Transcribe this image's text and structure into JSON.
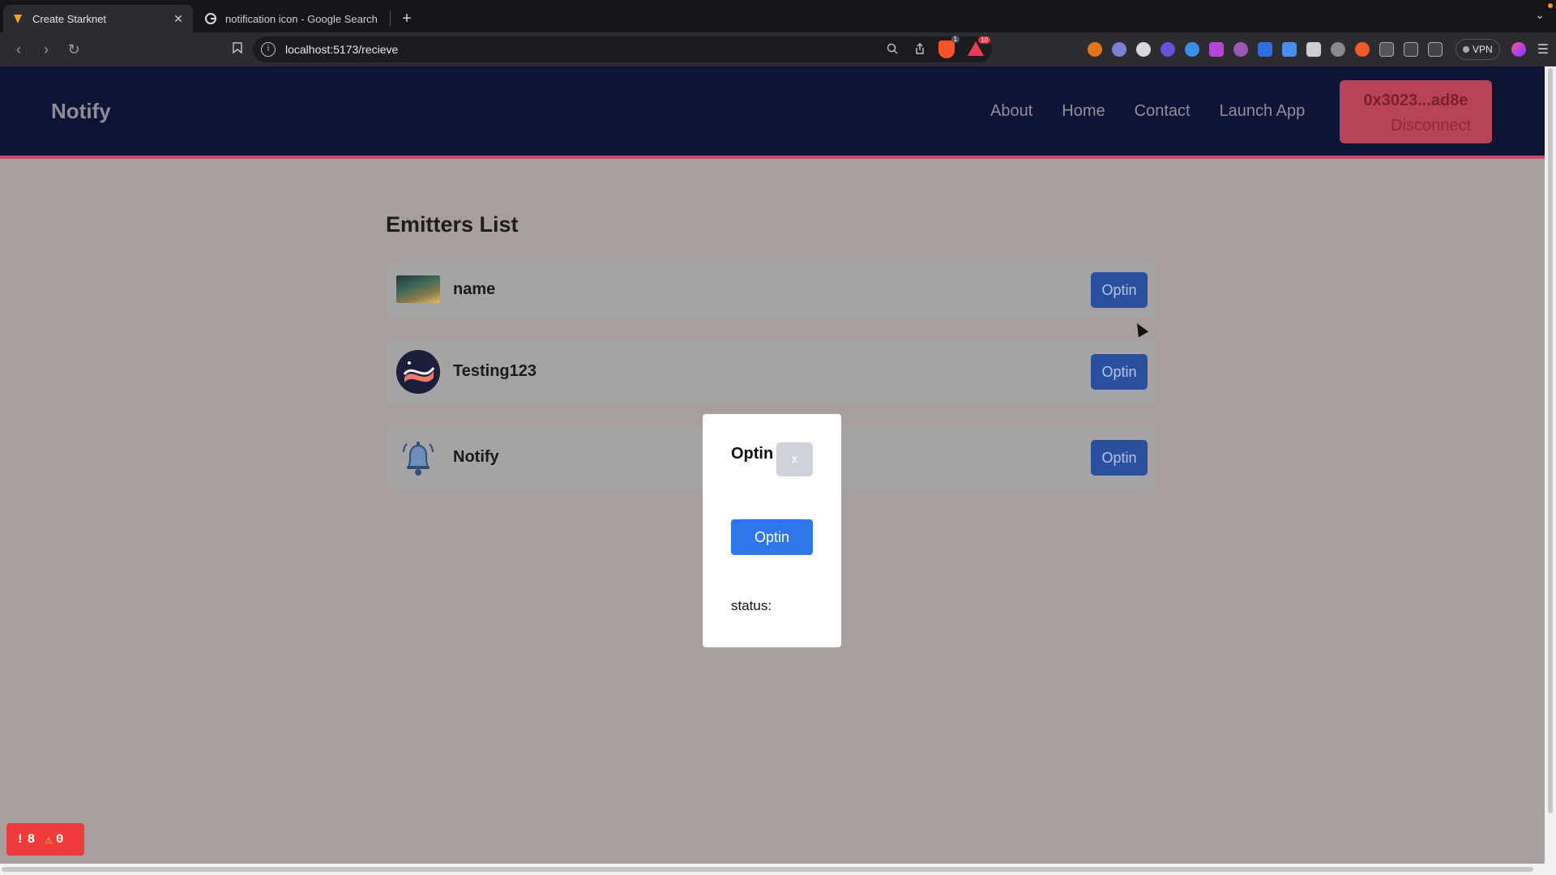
{
  "browser": {
    "tabs": [
      {
        "title": "Create Starknet",
        "active": true
      },
      {
        "title": "notification icon - Google Search",
        "active": false
      }
    ],
    "url": "localhost:5173/recieve",
    "shield_badge": "1",
    "rewards_badge": "10",
    "vpn_label": "VPN"
  },
  "navbar": {
    "brand": "Notify",
    "links": [
      "About",
      "Home",
      "Contact",
      "Launch App"
    ],
    "wallet_address": "0x3023...ad8e",
    "disconnect_label": "Disconnect"
  },
  "emitters": {
    "title": "Emitters List",
    "items": [
      {
        "name": "name",
        "button": "Optin"
      },
      {
        "name": "Testing123",
        "button": "Optin"
      },
      {
        "name": "Notify",
        "button": "Optin"
      }
    ]
  },
  "modal": {
    "title": "Optin",
    "close_label": "x",
    "action_label": "Optin",
    "status_label": "status:"
  },
  "dev_badge": {
    "errors": "8",
    "warnings": "0"
  },
  "colors": {
    "navbar_bg": "#0e1434",
    "accent": "#c94a63",
    "button_blue": "#2f76eb"
  }
}
